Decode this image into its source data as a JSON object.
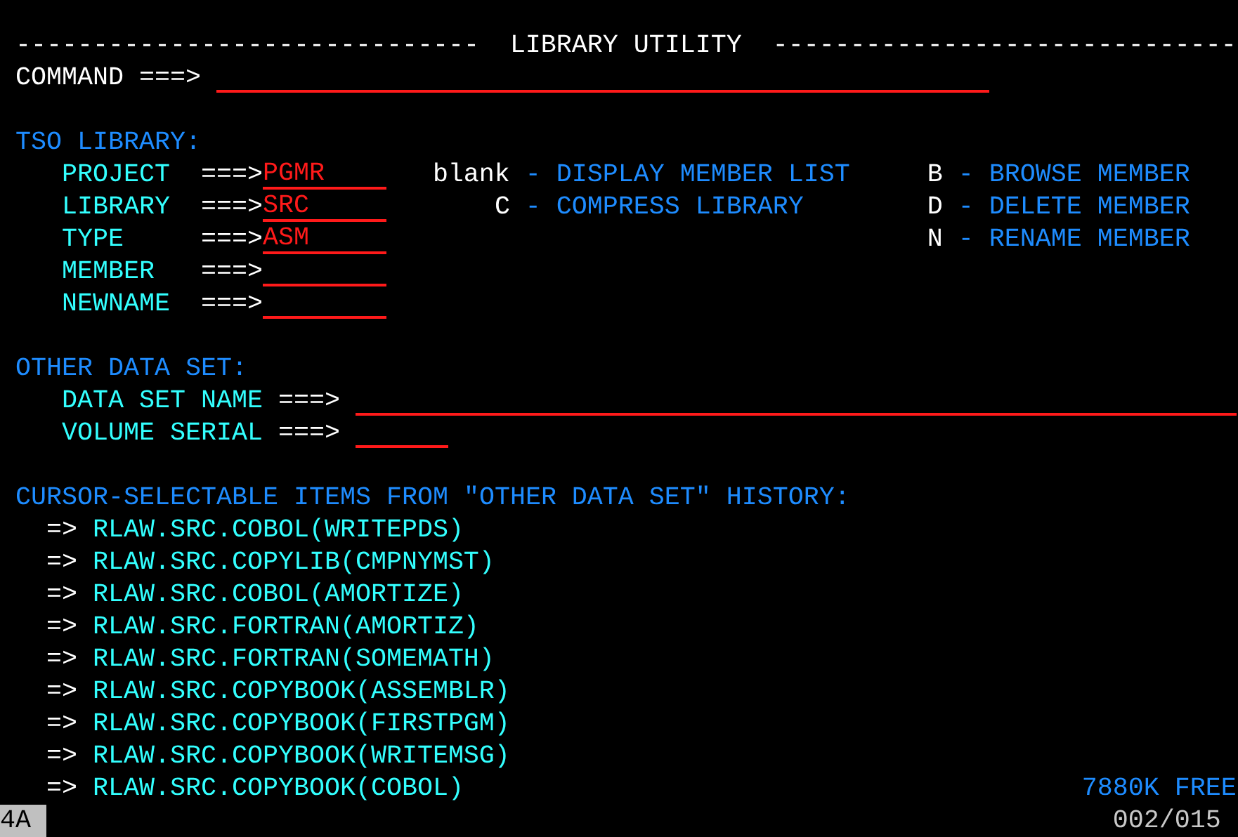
{
  "title": {
    "rule_left": "------------------------------",
    "text": "LIBRARY UTILITY",
    "rule_right": "------------------------------"
  },
  "command": {
    "label": "COMMAND ===>"
  },
  "tso_library": {
    "heading": "TSO LIBRARY:",
    "fields": [
      {
        "label": "PROJECT",
        "arrow": "===>",
        "value": "PGMR"
      },
      {
        "label": "LIBRARY",
        "arrow": "===>",
        "value": "SRC"
      },
      {
        "label": "TYPE",
        "arrow": "===>",
        "value": "ASM"
      },
      {
        "label": "MEMBER",
        "arrow": "===>"
      },
      {
        "label": "NEWNAME",
        "arrow": "===>"
      }
    ],
    "options": [
      {
        "key": "blank",
        "desc": "- DISPLAY MEMBER LIST"
      },
      {
        "key": "B",
        "desc": "- BROWSE MEMBER"
      },
      {
        "key": "C",
        "desc": "- COMPRESS LIBRARY"
      },
      {
        "key": "D",
        "desc": "- DELETE MEMBER"
      },
      {
        "key": "N",
        "desc": "- RENAME MEMBER"
      }
    ]
  },
  "other_data_set": {
    "heading": "OTHER DATA SET:",
    "fields": [
      {
        "label": "DATA SET NAME",
        "arrow": "===>"
      },
      {
        "label": "VOLUME SERIAL",
        "arrow": "===>"
      }
    ]
  },
  "history": {
    "heading": "CURSOR-SELECTABLE ITEMS FROM \"OTHER DATA SET\" HISTORY:",
    "items": [
      {
        "marker": "=>",
        "name": "RLAW.SRC.COBOL(WRITEPDS)"
      },
      {
        "marker": "=>",
        "name": "RLAW.SRC.COPYLIB(CMPNYMST)"
      },
      {
        "marker": "=>",
        "name": "RLAW.SRC.COBOL(AMORTIZE)"
      },
      {
        "marker": "=>",
        "name": "RLAW.SRC.FORTRAN(AMORTIZ)"
      },
      {
        "marker": "=>",
        "name": "RLAW.SRC.FORTRAN(SOMEMATH)"
      },
      {
        "marker": "=>",
        "name": "RLAW.SRC.COPYBOOK(ASSEMBLR)"
      },
      {
        "marker": "=>",
        "name": "RLAW.SRC.COPYBOOK(FIRSTPGM)"
      },
      {
        "marker": "=>",
        "name": "RLAW.SRC.COPYBOOK(WRITEMSG)"
      },
      {
        "marker": "=>",
        "name": "RLAW.SRC.COPYBOOK(COBOL)"
      }
    ]
  },
  "free_space": "7880K FREE",
  "status_bar": {
    "session": "4A",
    "cursor": "002/015"
  }
}
